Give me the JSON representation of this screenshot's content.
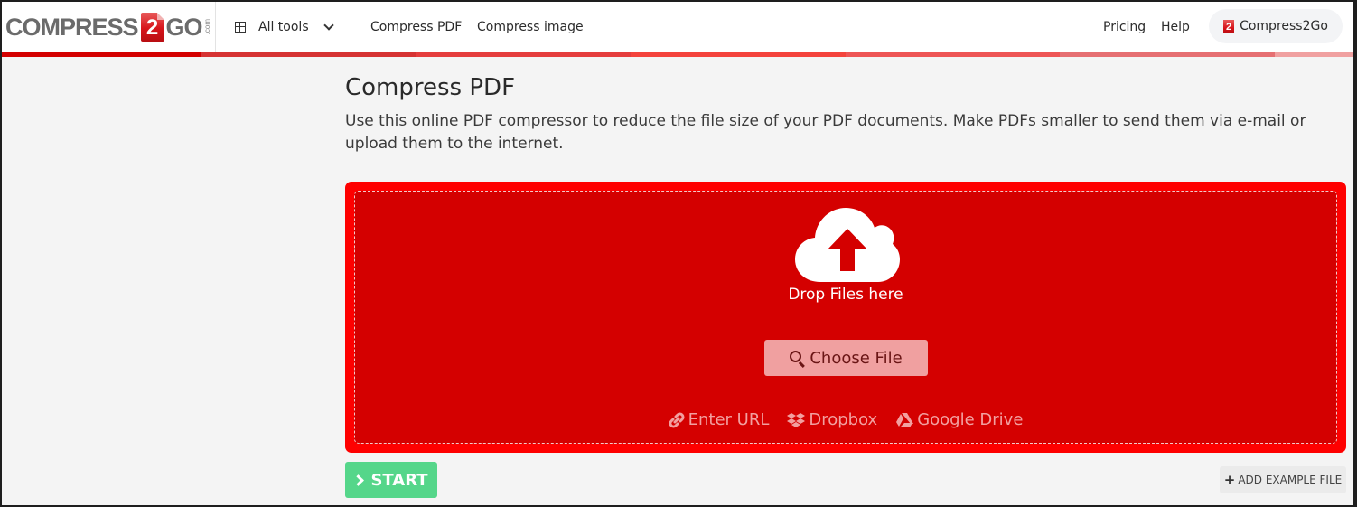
{
  "header": {
    "logo": {
      "text_left": "COMPRESS",
      "badge": "2",
      "text_right": "GO",
      "suffix": ".com"
    },
    "all_tools_label": "All tools",
    "nav_links": [
      "Compress PDF",
      "Compress image"
    ],
    "right_links": [
      "Pricing",
      "Help"
    ],
    "account_button": {
      "badge": "2",
      "label": "Compress2Go"
    },
    "stripe_colors": [
      "#d40000",
      "#d63333",
      "#e53d3d",
      "#f4433c",
      "#ee5555",
      "#e66f72",
      "#f0a0a0"
    ]
  },
  "main": {
    "title": "Compress PDF",
    "description": "Use this online PDF compressor to reduce the file size of your PDF documents. Make PDFs smaller to send them via e-mail or upload them to the internet.",
    "upload": {
      "icon": "cloud-upload-icon",
      "drop_text": "Drop Files here",
      "choose_file_label": "Choose File",
      "sources": [
        {
          "icon": "link-icon",
          "label": "Enter URL"
        },
        {
          "icon": "dropbox-icon",
          "label": "Dropbox"
        },
        {
          "icon": "google-drive-icon",
          "label": "Google Drive"
        }
      ]
    },
    "start_label": "START",
    "add_example_label": "ADD EXAMPLE FILE"
  },
  "colors": {
    "brand_red": "#fe0000",
    "upload_inner": "#d40000",
    "start_green": "#55d68a"
  }
}
